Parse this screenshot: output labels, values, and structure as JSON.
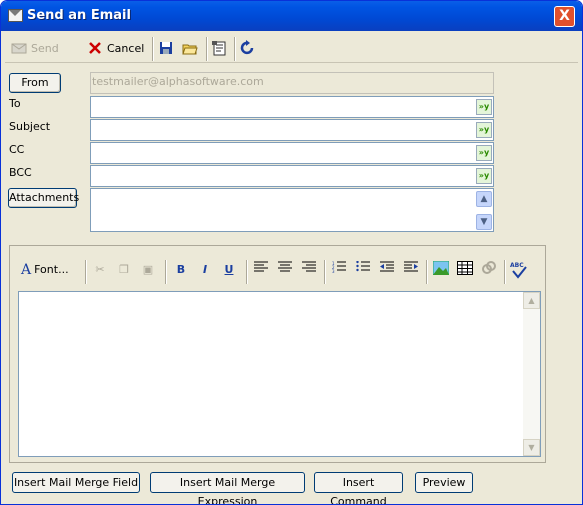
{
  "window": {
    "title": "Send an Email",
    "close_glyph": "X"
  },
  "toolbar": {
    "send_label": "Send",
    "cancel_label": "Cancel",
    "icons": [
      "save-icon",
      "open-folder-icon",
      "properties-icon",
      "refresh-icon"
    ]
  },
  "header_fields": {
    "from_button": "From",
    "from_value": "testmailer@alphasoftware.com",
    "to_label": "To",
    "subject_label": "Subject",
    "cc_label": "CC",
    "bcc_label": "BCC",
    "attachments_button": "Attachments",
    "field_button_glyph": "»y"
  },
  "format_toolbar": {
    "font_label": "Font...",
    "bold": "B",
    "italic": "I",
    "underline": "U",
    "spell": "ABC"
  },
  "bottom_buttons": {
    "insert_field": "Insert Mail Merge Field",
    "insert_expression": "Insert Mail Merge Expression",
    "insert_command": "Insert Command",
    "preview": "Preview"
  },
  "colors": {
    "titlebar": "#0054e3",
    "window_bg": "#ece9d8",
    "accent_green": "#2a8a00"
  }
}
